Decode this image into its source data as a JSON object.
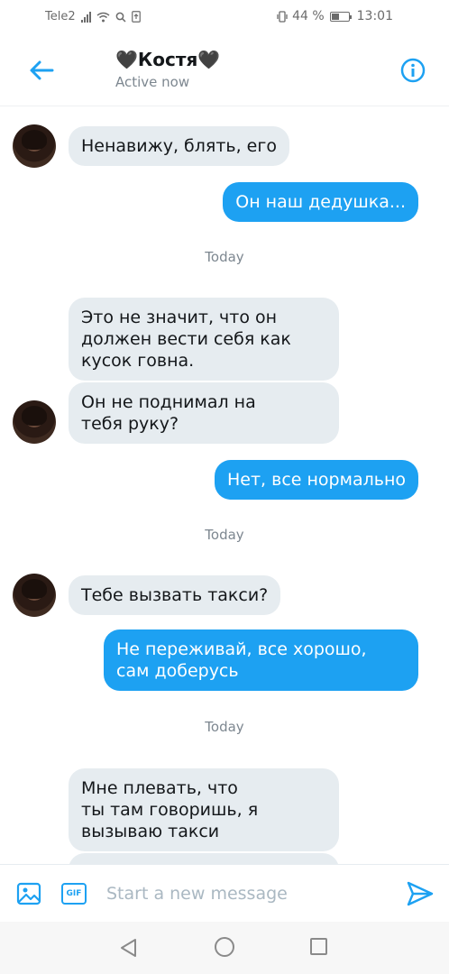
{
  "status_bar": {
    "carrier": "Tele2",
    "battery": "44 %",
    "time": "13:01"
  },
  "header": {
    "contact_name": "🖤Костя🖤",
    "status": "Active now"
  },
  "messages": [
    {
      "side": "in",
      "text": "Ненавижу, блять, его",
      "avatar": true
    },
    {
      "side": "out",
      "text": "Он наш дедушка..."
    },
    {
      "type": "timestamp",
      "text": "Today"
    },
    {
      "side": "in",
      "text": "Это не значит, что он\nдолжен вести себя как\nкусок говна."
    },
    {
      "side": "in",
      "text": "Он не поднимал на\nтебя руку?",
      "avatar": true
    },
    {
      "side": "out",
      "text": "Нет, все нормально"
    },
    {
      "type": "timestamp",
      "text": "Today"
    },
    {
      "side": "in",
      "text": "Тебе вызвать такси?",
      "avatar": true
    },
    {
      "side": "out",
      "text": "Не переживай, все хорошо,\nсам доберусь"
    },
    {
      "type": "timestamp",
      "text": "Today"
    },
    {
      "side": "in",
      "text": "Мне плевать, что\nты там говоришь, я\nвызываю такси"
    }
  ],
  "composer": {
    "placeholder": "Start a new message",
    "gif_label": "GIF"
  },
  "colors": {
    "accent": "#1da1f2",
    "incoming_bubble": "#e6ecf0"
  }
}
